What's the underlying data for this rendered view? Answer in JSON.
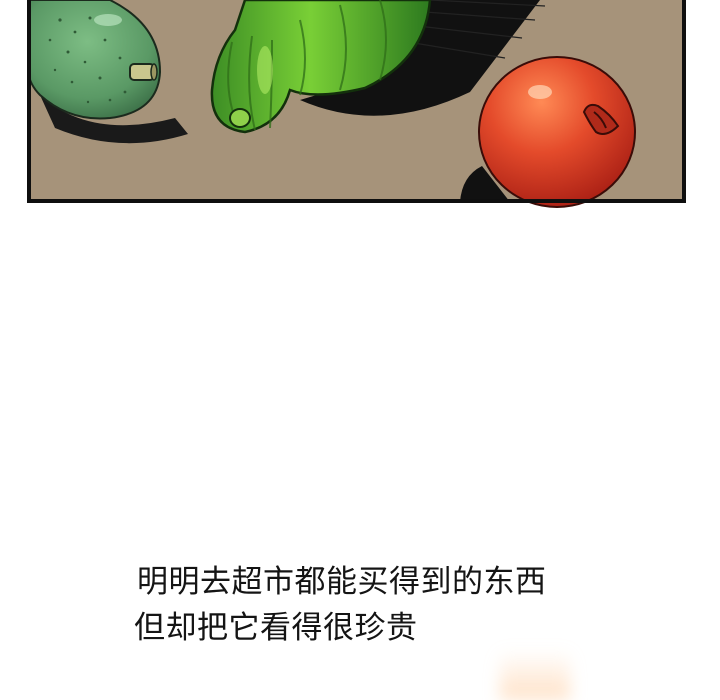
{
  "caption": {
    "line_1": "明明去超市都能买得到的东西",
    "line_2": "但却把它看得很珍贵"
  },
  "colors": {
    "panel_background": "#a6937a",
    "panel_border": "#0f0f0f",
    "avocado": "#5d9763",
    "green_vegetable": "#4aa22e",
    "tomato": "#d9452a",
    "text": "#141414"
  }
}
